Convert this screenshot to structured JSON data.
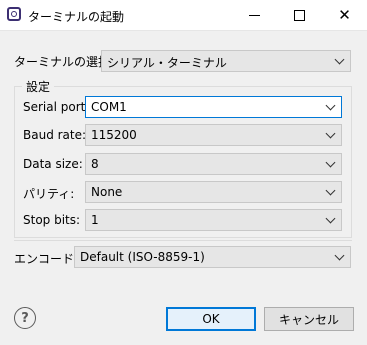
{
  "window": {
    "title": "ターミナルの起動",
    "close_symbol": "✕"
  },
  "terminal": {
    "label": "ターミナルの選択:",
    "value": "シリアル・ターミナル"
  },
  "settings": {
    "group_label": "設定",
    "serial_port": {
      "label": "Serial port:",
      "value": "COM1"
    },
    "baud_rate": {
      "label": "Baud rate:",
      "value": "115200"
    },
    "data_size": {
      "label": "Data size:",
      "value": "8"
    },
    "parity": {
      "label": "パリティ:",
      "value": "None"
    },
    "stop_bits": {
      "label": "Stop bits:",
      "value": "1"
    }
  },
  "encoding": {
    "label": "エンコード:",
    "value": "Default (ISO-8859-1)"
  },
  "help_symbol": "?",
  "buttons": {
    "ok": "OK",
    "cancel": "キャンセル"
  },
  "colors": {
    "accent": "#0078d7",
    "title_icon": "#3c2f72"
  }
}
